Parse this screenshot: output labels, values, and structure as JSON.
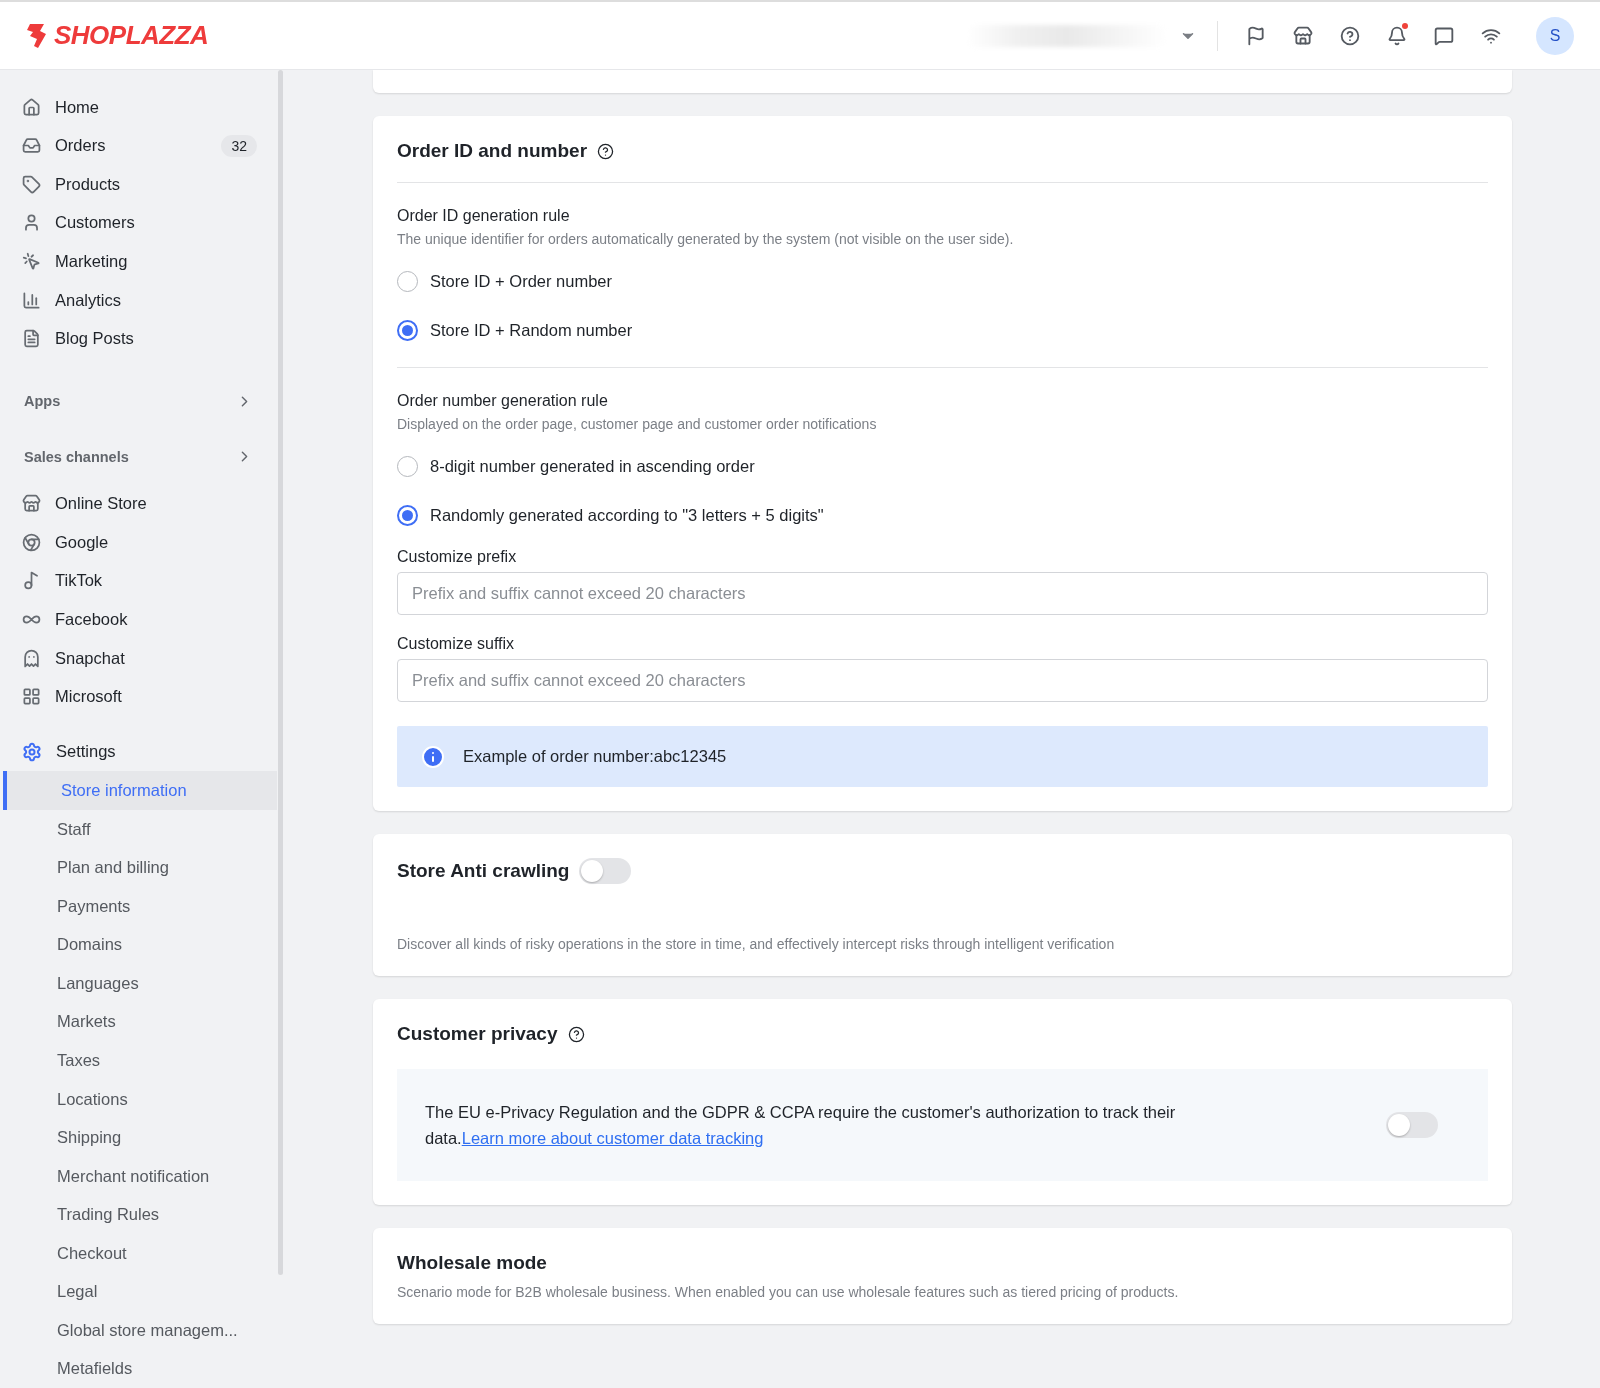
{
  "header": {
    "logo": "SHOPLAZZA",
    "has_unread_notifications": true,
    "avatar": "S"
  },
  "sidebar": {
    "main": [
      {
        "label": "Home"
      },
      {
        "label": "Orders",
        "badge": "32"
      },
      {
        "label": "Products"
      },
      {
        "label": "Customers"
      },
      {
        "label": "Marketing"
      },
      {
        "label": "Analytics"
      },
      {
        "label": "Blog Posts"
      }
    ],
    "apps": {
      "label": "Apps"
    },
    "sales_channels": {
      "label": "Sales channels",
      "items": [
        {
          "label": "Online Store"
        },
        {
          "label": "Google"
        },
        {
          "label": "TikTok"
        },
        {
          "label": "Facebook"
        },
        {
          "label": "Snapchat"
        },
        {
          "label": "Microsoft"
        }
      ]
    },
    "settings": {
      "label": "Settings",
      "children": [
        {
          "label": "Store information",
          "selected": true
        },
        {
          "label": "Staff",
          "selected": false
        },
        {
          "label": "Plan and billing",
          "selected": false
        },
        {
          "label": "Payments",
          "selected": false
        },
        {
          "label": "Domains",
          "selected": false
        },
        {
          "label": "Languages",
          "selected": false
        },
        {
          "label": "Markets",
          "selected": false
        },
        {
          "label": "Taxes",
          "selected": false
        },
        {
          "label": "Locations",
          "selected": false
        },
        {
          "label": "Shipping",
          "selected": false
        },
        {
          "label": "Merchant notification",
          "selected": false
        },
        {
          "label": "Trading Rules",
          "selected": false
        },
        {
          "label": "Checkout",
          "selected": false
        },
        {
          "label": "Legal",
          "selected": false
        },
        {
          "label": "Global store managem...",
          "selected": false
        },
        {
          "label": "Metafields",
          "selected": false
        }
      ]
    }
  },
  "order_id_card": {
    "title": "Order ID and number",
    "id_rule": {
      "label": "Order ID generation rule",
      "description": "The unique identifier for orders automatically generated by the system (not visible on the user side).",
      "options": [
        {
          "label": "Store ID + Order number",
          "selected": false
        },
        {
          "label": "Store ID + Random number",
          "selected": true
        }
      ]
    },
    "number_rule": {
      "label": "Order number generation rule",
      "description": "Displayed on the order page, customer page and customer order notifications",
      "options": [
        {
          "label": "8-digit number generated in ascending order",
          "selected": false
        },
        {
          "label": "Randomly generated according to \"3 letters + 5 digits\"",
          "selected": true
        }
      ]
    },
    "prefix": {
      "label": "Customize prefix",
      "placeholder": "Prefix and suffix cannot exceed 20 characters"
    },
    "suffix": {
      "label": "Customize suffix",
      "placeholder": "Prefix and suffix cannot exceed 20 characters"
    },
    "example": "Example of order number:abc12345"
  },
  "anti_crawling_card": {
    "title": "Store Anti crawling",
    "on": false,
    "description": "Discover all kinds of risky operations in the store in time, and effectively intercept risks through intelligent verification"
  },
  "privacy_card": {
    "title": "Customer privacy",
    "text": "The EU e-Privacy Regulation and the GDPR & CCPA require the customer's authorization to track their data.",
    "link": "Learn more about customer data tracking",
    "on": false
  },
  "wholesale_card": {
    "title": "Wholesale mode",
    "description": "Scenario mode for B2B wholesale business. When enabled you can use wholesale features such as tiered pricing of products."
  }
}
